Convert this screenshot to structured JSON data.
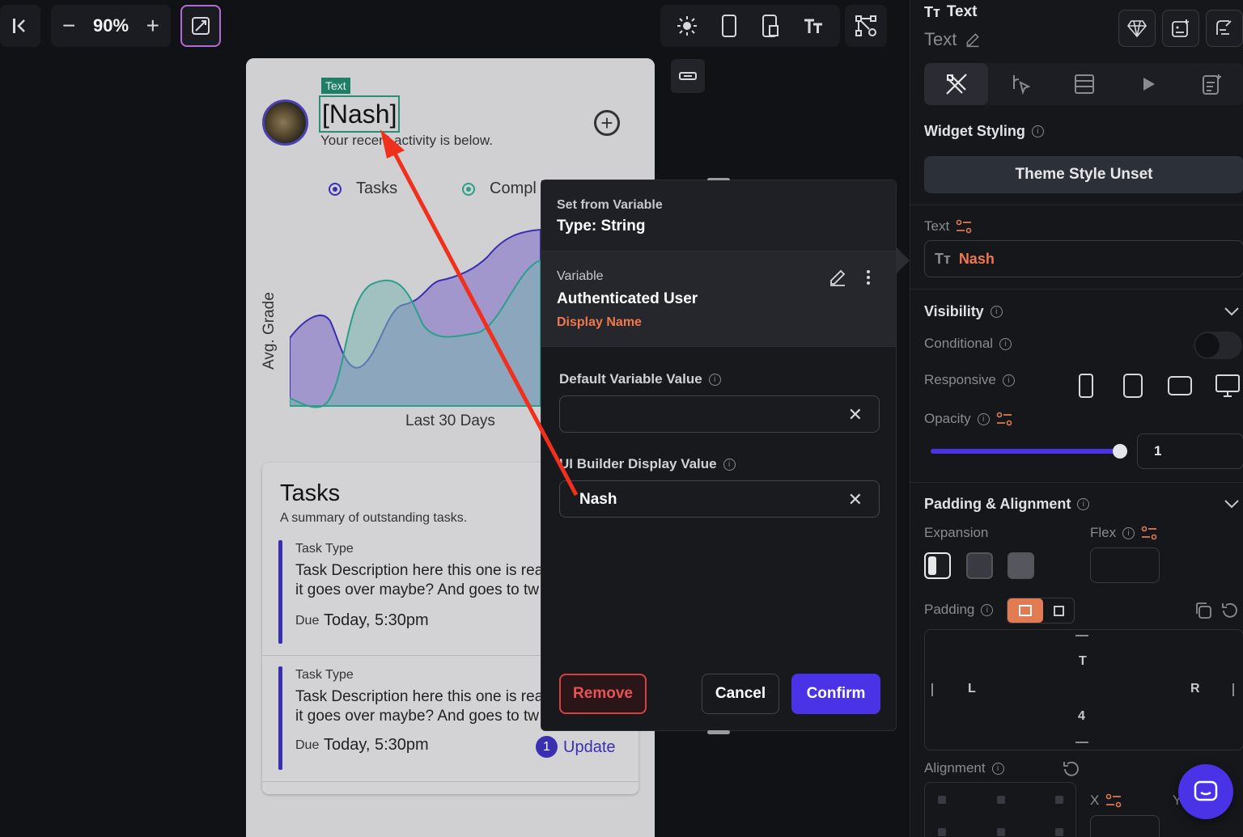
{
  "toolbar": {
    "zoom": "90%",
    "zoom_minus": "−",
    "zoom_plus": "+"
  },
  "canvas": {
    "text_tag": "Text",
    "name_text": "[Nash]",
    "activity_text": "Your recent activity is below.",
    "legend": [
      {
        "label": "Tasks",
        "color": "#3a2fb0"
      },
      {
        "label": "Compl",
        "color": "#2aa08a"
      }
    ],
    "chart_ylabel": "Avg. Grade",
    "chart_xlabel": "Last 30 Days",
    "tasks_title": "Tasks",
    "tasks_subtitle": "A summary of outstanding tasks.",
    "tasks": [
      {
        "type": "Task Type",
        "desc1": "Task Description here this one is rea",
        "desc2": "it goes over maybe? And goes to tw",
        "due_label": "Due",
        "due_value": "Today, 5:30pm"
      },
      {
        "type": "Task Type",
        "desc1": "Task Description here this one is rea",
        "desc2": "it goes over maybe? And goes to tw",
        "due_label": "Due",
        "due_value": "Today, 5:30pm",
        "badge": "1",
        "action": "Update"
      }
    ]
  },
  "popup": {
    "header_label": "Set from Variable",
    "header_type": "Type: String",
    "variable_label": "Variable",
    "variable_name": "Authenticated User",
    "variable_field": "Display Name",
    "default_label": "Default Variable Value",
    "default_value": "",
    "ui_label": "UI Builder Display Value",
    "ui_value": "Nash",
    "remove": "Remove",
    "cancel": "Cancel",
    "confirm": "Confirm"
  },
  "panel": {
    "title": "Text",
    "subtitle": "Text",
    "widget_styling": "Widget Styling",
    "theme_style": "Theme Style Unset",
    "text_label": "Text",
    "text_value": "Nash",
    "visibility": "Visibility",
    "conditional": "Conditional",
    "responsive": "Responsive",
    "opacity": "Opacity",
    "opacity_value": "1",
    "opacity_level": 1.0,
    "padding_alignment": "Padding & Alignment",
    "expansion": "Expansion",
    "flex": "Flex",
    "padding": "Padding",
    "pad_t": "T",
    "pad_l": "L",
    "pad_r": "R",
    "pad_b": "4",
    "alignment": "Alignment",
    "align_x": "X",
    "align_y": "Y"
  },
  "colors": {
    "accent": "#4a33e6",
    "orange": "#f0784c",
    "remove_red": "#e85454",
    "arrow_red": "#f0301c"
  }
}
